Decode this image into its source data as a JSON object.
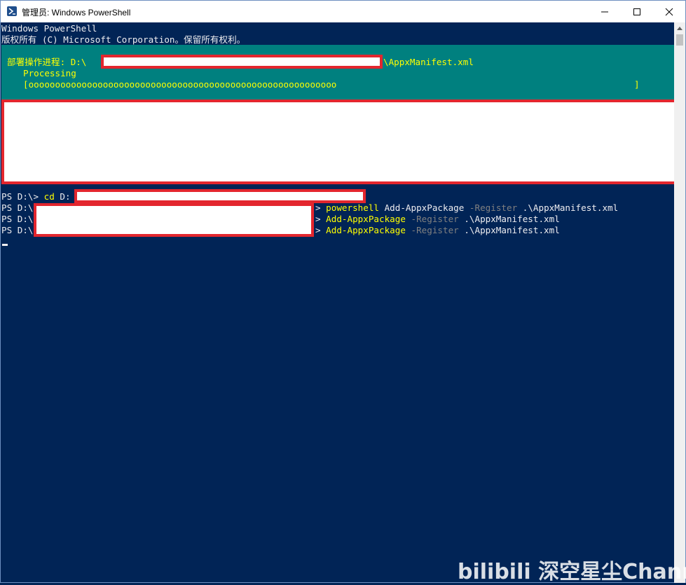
{
  "window": {
    "title": "管理员: Windows PowerShell"
  },
  "header_lines": [
    "Windows PowerShell",
    "版权所有 (C) Microsoft Corporation。保留所有权利。"
  ],
  "progress": {
    "label_prefix": "部署操作进程: D:\\",
    "label_suffix": "\\AppxManifest.xml",
    "status": "Processing",
    "bar_open": "[",
    "bar_fill": "oooooooooooooooooooooooooooooooooooooooooooooooooooooooooo",
    "bar_close": "]"
  },
  "commands": [
    {
      "prompt": "PS D:\\> ",
      "cmd": "cd",
      "rest": " D:"
    },
    {
      "prompt": "PS D:\\",
      "tail_prompt": "> ",
      "cmd": "powershell",
      "rest": " Add-AppxPackage ",
      "param": "-Register",
      "path": " .\\AppxManifest.xml"
    },
    {
      "prompt": "PS D:\\",
      "tail_prompt": "> ",
      "cmd": "Add-AppxPackage",
      "param": " -Register",
      "path": " .\\AppxManifest.xml"
    },
    {
      "prompt": "PS D:\\",
      "tail_prompt": "> ",
      "cmd": "Add-AppxPackage",
      "param": " -Register",
      "path": " .\\AppxManifest.xml"
    }
  ],
  "watermark": "bilibili 深空星尘Channe",
  "colors": {
    "console_bg": "#012456",
    "progress_bg": "#00807f",
    "highlight": "#ffff00",
    "redaction_border": "#e3262e"
  }
}
